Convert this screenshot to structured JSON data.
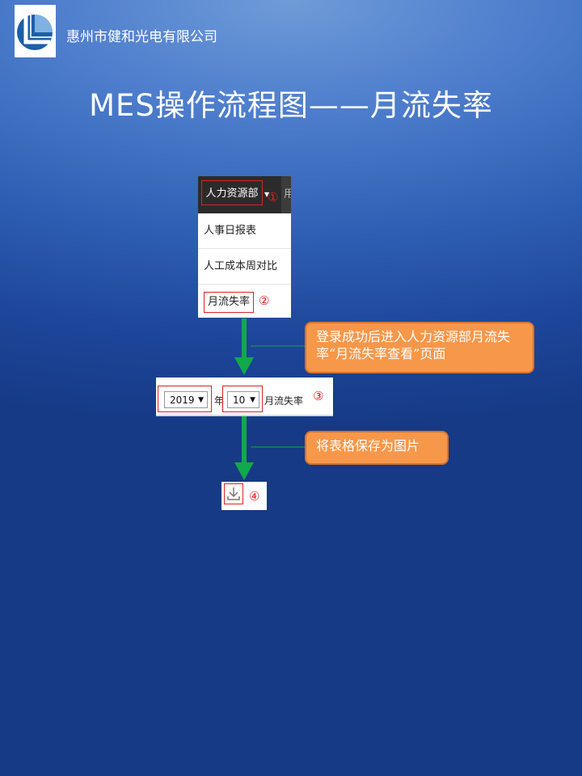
{
  "header": {
    "company": "惠州市健和光电有限公司"
  },
  "title": "MES操作流程图——月流失率",
  "menu": {
    "hr_label": "人力资源部",
    "next_label": "用",
    "items": [
      {
        "label": "人事日报表"
      },
      {
        "label": "人工成本周对比"
      },
      {
        "label": "月流失率"
      }
    ]
  },
  "form": {
    "year_value": "2019",
    "year_unit": "年",
    "month_value": "10",
    "month_unit": "月流失率"
  },
  "steps": {
    "s1": "①",
    "s2": "②",
    "s3": "③",
    "s4": "④"
  },
  "notes": {
    "n1": "登录成功后进入人力资源部月流失率“月流失率查看”页面",
    "n2": "将表格保存为图片"
  },
  "colors": {
    "arrow": "#12a84c",
    "note_fill": "#f7974a",
    "highlight": "#e02020"
  }
}
